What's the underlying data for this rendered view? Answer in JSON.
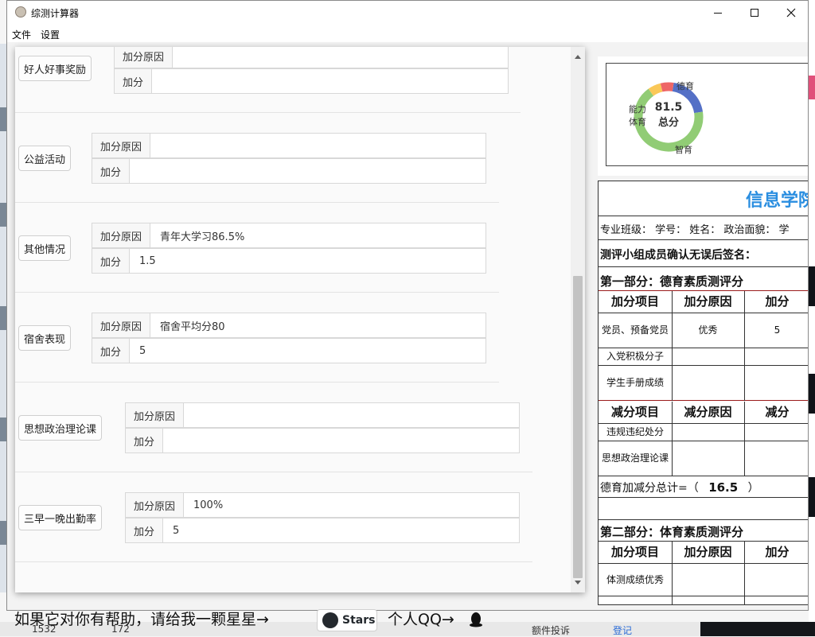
{
  "window": {
    "title": "综测计算器",
    "menu": [
      "文件",
      "设置"
    ]
  },
  "left_panel": {
    "field_labels": {
      "reason": "加分原因",
      "points": "加分"
    },
    "sections": [
      {
        "category": "好人好事奖励",
        "reason": "",
        "points": ""
      },
      {
        "category": "公益活动",
        "reason": "",
        "points": ""
      },
      {
        "category": "其他情况",
        "reason": "青年大学习86.5%",
        "points": "1.5"
      },
      {
        "category": "宿舍表现",
        "reason": "宿舍平均分80",
        "points": "5"
      },
      {
        "category": "思想政治理论课",
        "reason": "",
        "points": ""
      },
      {
        "category": "三早一晚出勤率",
        "reason": "100%",
        "points": "5"
      }
    ]
  },
  "chart_data": {
    "type": "pie",
    "center_value": "81.5",
    "center_label": "总分",
    "categories": [
      "德育",
      "智育",
      "体育",
      "能力"
    ],
    "values": [
      16.5,
      55,
      5,
      5
    ],
    "colors": [
      "#5470c6",
      "#91cc75",
      "#fac858",
      "#ee6666"
    ]
  },
  "form": {
    "title": "信息学院",
    "info_line": "专业班级：  学号：  姓名：     政治面貌：   学",
    "confirm_line": "测评小组成员确认无误后签名：",
    "part1_title": "第一部分：德育素质测评分",
    "add_headers": [
      "加分项目",
      "加分原因",
      "加分"
    ],
    "add_rows": [
      [
        "党员、预备党员",
        "优秀",
        "5"
      ],
      [
        "入党积极分子",
        "",
        ""
      ],
      [
        "学生手册成绩",
        "",
        ""
      ]
    ],
    "sub_headers": [
      "减分项目",
      "减分原因",
      "减分"
    ],
    "sub_rows": [
      [
        "违规违纪处分",
        "",
        ""
      ],
      [
        "思想政治理论课",
        "",
        ""
      ]
    ],
    "total_prefix": "德育加减分总计=（",
    "total_value": "16.5",
    "total_suffix": "）",
    "part2_title": "第二部分：体育素质测评分",
    "part2_headers": [
      "加分项目",
      "加分原因",
      "加分"
    ],
    "part2_rows": [
      [
        "体测成绩优秀",
        "",
        ""
      ]
    ]
  },
  "banner": {
    "help_text": "如果它对你有帮助，请给我一颗星星→",
    "stars_label": "Stars",
    "qq_text": "个人QQ→"
  },
  "taskbar": {
    "count_a": "1532",
    "count_b": "172",
    "item_text": "额件投诉",
    "login_text": "登记"
  }
}
